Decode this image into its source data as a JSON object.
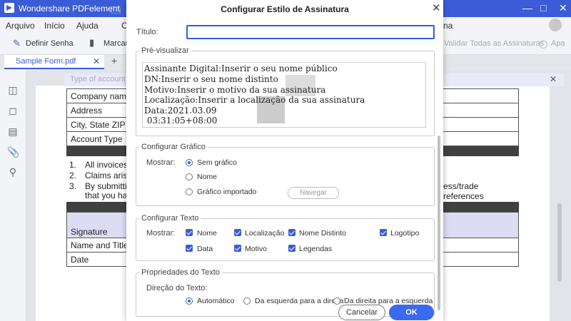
{
  "app": {
    "title": "Wondershare PDFelement",
    "icons": {
      "logo": "pdfelement-logo",
      "folder": "folder-icon",
      "minimize": "minimize-icon",
      "maximize": "maximize-icon",
      "close": "close-icon"
    }
  },
  "menu": {
    "items": [
      "Arquivo",
      "Início",
      "Ajuda",
      "Co",
      "na"
    ]
  },
  "toolbar": {
    "define_password": "Definir Senha",
    "mark": "Marcar",
    "validate_all": "Validar Todas as Assinaturas",
    "clear": "Apa"
  },
  "tabs": {
    "active": "Sample Form.pdf",
    "add": "+"
  },
  "document": {
    "form_notice_placeholder": "Type of account",
    "rows": [
      "Company name",
      "Address",
      "City, State ZIP C",
      "Account Type"
    ],
    "list": [
      {
        "num": "1.",
        "text": "All invoices a"
      },
      {
        "num": "2.",
        "text": "Claims arisin"
      },
      {
        "num": "3.",
        "text": "By submittin"
      }
    ],
    "list_cont": "that you hav",
    "list_right": "ess/trade references",
    "sig_rows": [
      "Signature",
      "Name and Title",
      "Date"
    ]
  },
  "dialog": {
    "title": "Configurar Estilo de Assinatura",
    "titulo_label": "Título:",
    "titulo_value": "",
    "preview": {
      "legend": "Pré-visualizar",
      "lines": [
        "Assinante Digital:Inserir o seu nome público",
        "DN:Inserir o seu nome distinto",
        "Motivo:Inserir o motivo da sua assinatura",
        "Localização:Inserir a localização da sua assinatura",
        "Data:2021.03.09",
        " 03:31:05+08:00"
      ]
    },
    "graphic": {
      "legend": "Configurar Gráfico",
      "show_label": "Mostrar:",
      "options": [
        "Sem gráfico",
        "Nome",
        "Gráfico importado"
      ],
      "selected": "Sem gráfico",
      "browse_button": "Navegar"
    },
    "text": {
      "legend": "Configurar Texto",
      "show_label": "Mostrar:",
      "checkboxes": [
        {
          "label": "Nome",
          "checked": true
        },
        {
          "label": "Localização",
          "checked": true
        },
        {
          "label": "Nome Distinto",
          "checked": true
        },
        {
          "label": "Logotipo",
          "checked": true
        },
        {
          "label": "Data",
          "checked": true
        },
        {
          "label": "Motivo",
          "checked": true
        },
        {
          "label": "Legendas",
          "checked": true
        }
      ]
    },
    "text_props": {
      "legend": "Propriedades do Texto",
      "direction_label": "Direção do Texto:",
      "options": [
        "Automático",
        "Da esquerda para a direita",
        "Da direita para a esquerda"
      ],
      "selected": "Automático"
    },
    "cancel_button": "Cancelar",
    "ok_button": "OK"
  },
  "colors": {
    "accent": "#3b5cd6",
    "titlebar": "#3b5cd6",
    "ok_button": "#3b6af0"
  }
}
